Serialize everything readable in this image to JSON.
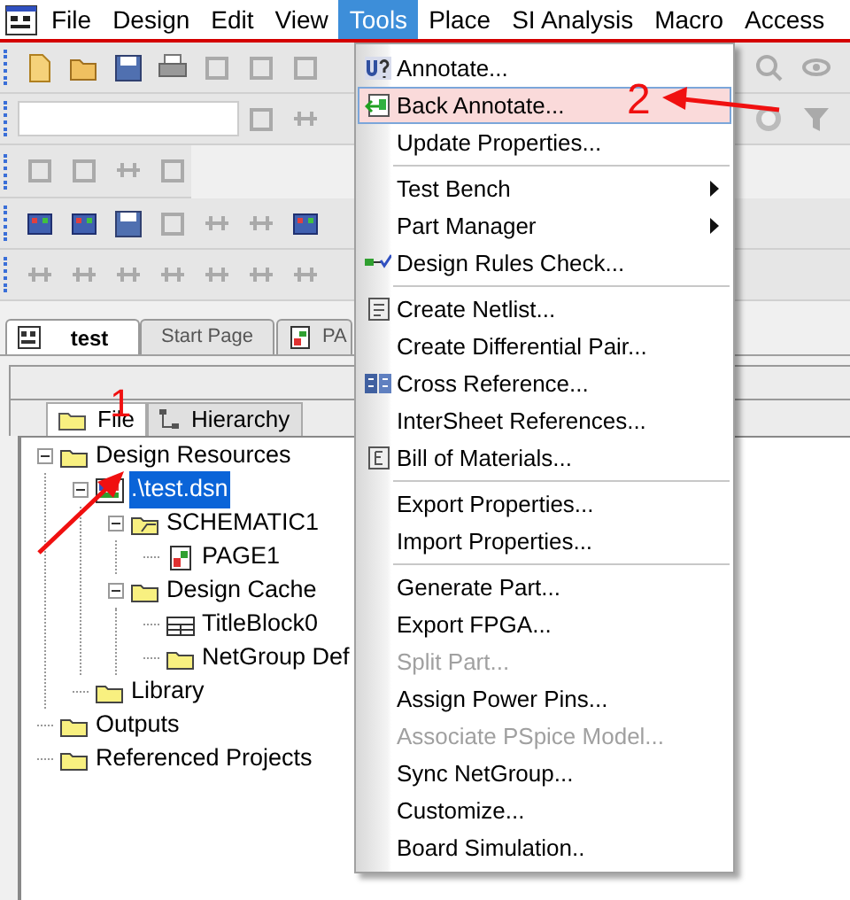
{
  "menubar": [
    {
      "label": "File",
      "selected": false
    },
    {
      "label": "Design",
      "selected": false
    },
    {
      "label": "Edit",
      "selected": false
    },
    {
      "label": "View",
      "selected": false
    },
    {
      "label": "Tools",
      "selected": true
    },
    {
      "label": "Place",
      "selected": false
    },
    {
      "label": "SI Analysis",
      "selected": false
    },
    {
      "label": "Macro",
      "selected": false
    },
    {
      "label": "Access",
      "selected": false
    }
  ],
  "document_tabs": [
    {
      "label": "test",
      "selected": true
    },
    {
      "label": "Start Page",
      "selected": false
    },
    {
      "label": "PA",
      "selected": false
    }
  ],
  "project_panel": {
    "tabs": [
      {
        "label": "File",
        "selected": true
      },
      {
        "label": "Hierarchy",
        "selected": false
      }
    ],
    "tree": [
      {
        "label": "Design Resources",
        "kind": "folder",
        "selected": false,
        "expanded": true,
        "children": [
          {
            "label": ".\\test.dsn",
            "kind": "design",
            "selected": true,
            "expanded": true,
            "children": [
              {
                "label": "SCHEMATIC1",
                "kind": "open-folder",
                "selected": false,
                "expanded": true,
                "children": [
                  {
                    "label": "PAGE1",
                    "kind": "page",
                    "selected": false
                  }
                ]
              },
              {
                "label": "Design Cache",
                "kind": "folder",
                "selected": false,
                "expanded": true,
                "children": [
                  {
                    "label": "TitleBlock0",
                    "kind": "block",
                    "selected": false
                  },
                  {
                    "label": "NetGroup Def",
                    "kind": "folder",
                    "selected": false
                  }
                ]
              }
            ]
          },
          {
            "label": "Library",
            "kind": "folder",
            "selected": false
          }
        ]
      },
      {
        "label": "Outputs",
        "kind": "folder",
        "selected": false
      },
      {
        "label": "Referenced Projects",
        "kind": "folder",
        "selected": false
      }
    ]
  },
  "tools_menu": {
    "items": [
      {
        "kind": "item",
        "label": "Annotate...",
        "selected": false,
        "disabled": false,
        "submenu": false
      },
      {
        "kind": "item",
        "label": "Back Annotate...",
        "selected": true,
        "disabled": false,
        "submenu": false
      },
      {
        "kind": "item",
        "label": "Update Properties...",
        "selected": false,
        "disabled": false,
        "submenu": false
      },
      {
        "kind": "separator"
      },
      {
        "kind": "item",
        "label": "Test Bench",
        "selected": false,
        "disabled": false,
        "submenu": true
      },
      {
        "kind": "item",
        "label": "Part Manager",
        "selected": false,
        "disabled": false,
        "submenu": true
      },
      {
        "kind": "item",
        "label": "Design Rules Check...",
        "selected": false,
        "disabled": false,
        "submenu": false
      },
      {
        "kind": "separator"
      },
      {
        "kind": "item",
        "label": "Create Netlist...",
        "selected": false,
        "disabled": false,
        "submenu": false
      },
      {
        "kind": "item",
        "label": "Create Differential Pair...",
        "selected": false,
        "disabled": false,
        "submenu": false
      },
      {
        "kind": "item",
        "label": "Cross Reference...",
        "selected": false,
        "disabled": false,
        "submenu": false
      },
      {
        "kind": "item",
        "label": "InterSheet References...",
        "selected": false,
        "disabled": false,
        "submenu": false
      },
      {
        "kind": "item",
        "label": "Bill of Materials...",
        "selected": false,
        "disabled": false,
        "submenu": false
      },
      {
        "kind": "separator"
      },
      {
        "kind": "item",
        "label": "Export Properties...",
        "selected": false,
        "disabled": false,
        "submenu": false
      },
      {
        "kind": "item",
        "label": "Import Properties...",
        "selected": false,
        "disabled": false,
        "submenu": false
      },
      {
        "kind": "separator"
      },
      {
        "kind": "item",
        "label": "Generate Part...",
        "selected": false,
        "disabled": false,
        "submenu": false
      },
      {
        "kind": "item",
        "label": "Export FPGA...",
        "selected": false,
        "disabled": false,
        "submenu": false
      },
      {
        "kind": "item",
        "label": "Split Part...",
        "selected": false,
        "disabled": true,
        "submenu": false
      },
      {
        "kind": "item",
        "label": "Assign Power Pins...",
        "selected": false,
        "disabled": false,
        "submenu": false
      },
      {
        "kind": "item",
        "label": "Associate PSpice Model...",
        "selected": false,
        "disabled": true,
        "submenu": false
      },
      {
        "kind": "item",
        "label": "Sync NetGroup...",
        "selected": false,
        "disabled": false,
        "submenu": false
      },
      {
        "kind": "item",
        "label": "Customize...",
        "selected": false,
        "disabled": false,
        "submenu": false
      },
      {
        "kind": "item",
        "label": "Board Simulation..",
        "selected": false,
        "disabled": false,
        "submenu": false
      }
    ]
  },
  "annotations": [
    {
      "label": "1"
    },
    {
      "label": "2"
    }
  ]
}
